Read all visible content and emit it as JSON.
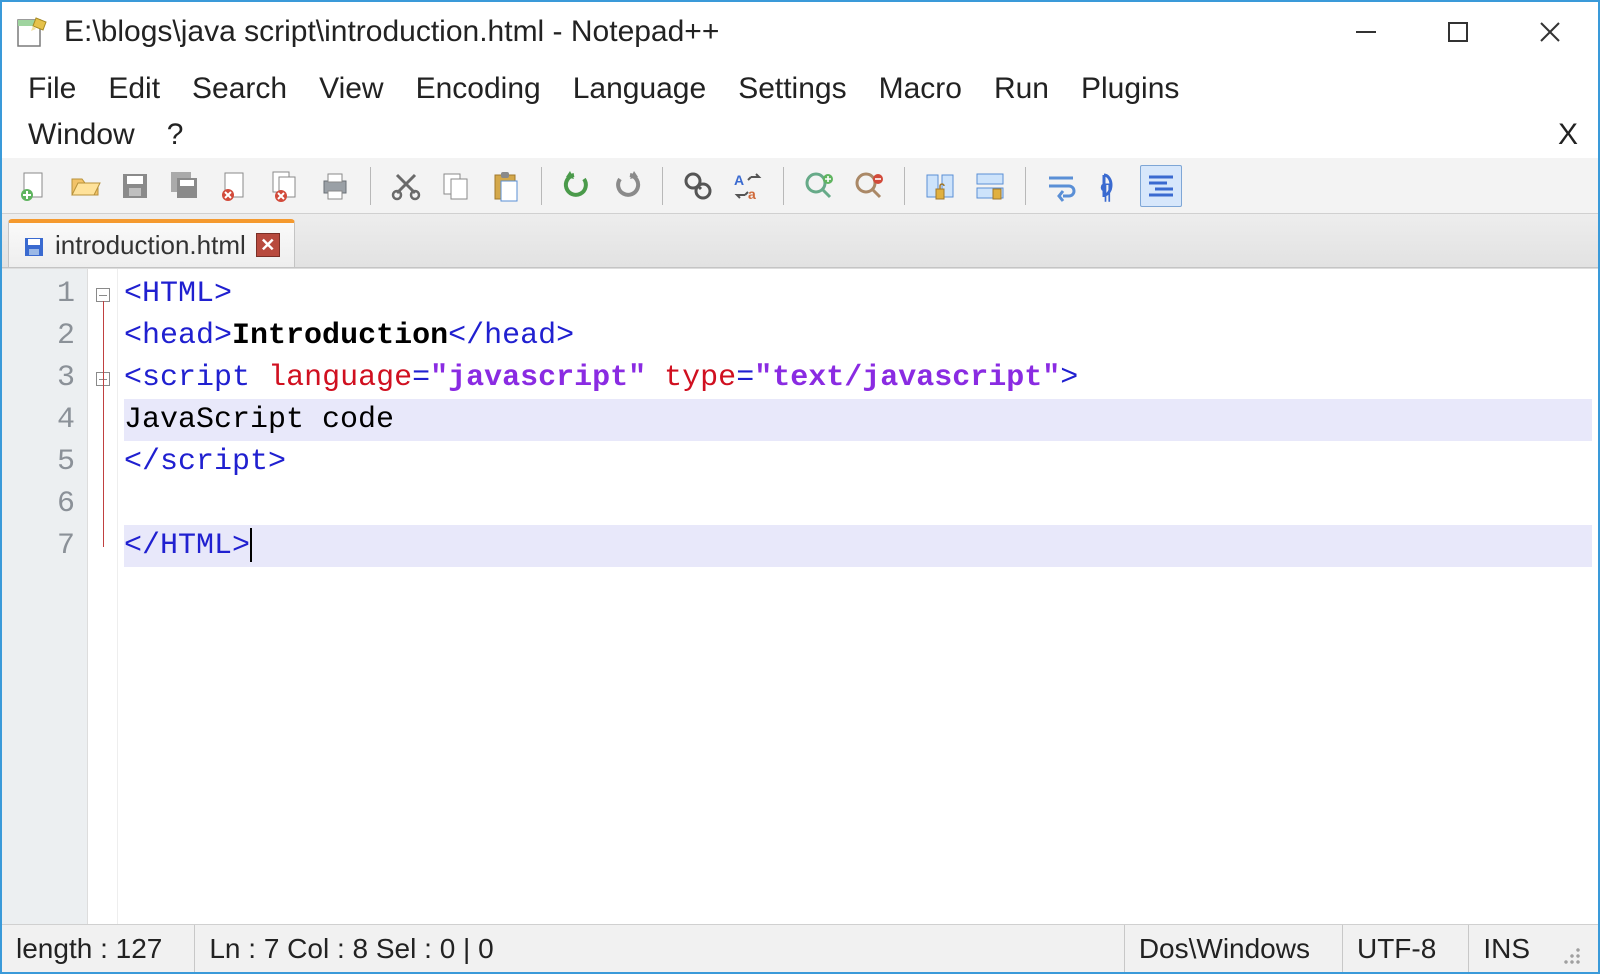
{
  "titlebar": {
    "title": "E:\\blogs\\java script\\introduction.html - Notepad++"
  },
  "menu": {
    "items": [
      "File",
      "Edit",
      "Search",
      "View",
      "Encoding",
      "Language",
      "Settings",
      "Macro",
      "Run",
      "Plugins",
      "Window",
      "?"
    ]
  },
  "toolbar": {
    "icons": [
      "new-file",
      "open-file",
      "save",
      "save-all",
      "close-file",
      "close-all",
      "print",
      "cut",
      "copy",
      "paste",
      "undo",
      "redo",
      "find",
      "replace",
      "zoom-in",
      "zoom-out",
      "sync-v",
      "sync-h",
      "word-wrap",
      "show-all",
      "doc-map"
    ]
  },
  "tab": {
    "filename": "introduction.html"
  },
  "code": {
    "lines": [
      {
        "n": 1,
        "segments": [
          {
            "t": "<",
            "c": "tok-angle"
          },
          {
            "t": "HTML",
            "c": "tok-tag"
          },
          {
            "t": ">",
            "c": "tok-angle"
          }
        ]
      },
      {
        "n": 2,
        "segments": [
          {
            "t": "<",
            "c": "tok-angle"
          },
          {
            "t": "head",
            "c": "tok-tag"
          },
          {
            "t": ">",
            "c": "tok-angle"
          },
          {
            "t": "Introduction",
            "c": "tok-text tok-bold"
          },
          {
            "t": "</",
            "c": "tok-angle"
          },
          {
            "t": "head",
            "c": "tok-tag"
          },
          {
            "t": ">",
            "c": "tok-angle"
          }
        ]
      },
      {
        "n": 3,
        "segments": [
          {
            "t": "<",
            "c": "tok-angle"
          },
          {
            "t": "script",
            "c": "tok-tag"
          },
          {
            "t": " ",
            "c": ""
          },
          {
            "t": "language",
            "c": "tok-attr"
          },
          {
            "t": "=",
            "c": "tok-angle"
          },
          {
            "t": "\"javascript\"",
            "c": "tok-val"
          },
          {
            "t": " ",
            "c": ""
          },
          {
            "t": "type",
            "c": "tok-attr"
          },
          {
            "t": "=",
            "c": "tok-angle"
          },
          {
            "t": "\"text/javascript\"",
            "c": "tok-val"
          },
          {
            "t": ">",
            "c": "tok-angle"
          }
        ]
      },
      {
        "n": 4,
        "hl": true,
        "segments": [
          {
            "t": "JavaScript code",
            "c": "tok-text"
          }
        ]
      },
      {
        "n": 5,
        "segments": [
          {
            "t": "</",
            "c": "tok-angle"
          },
          {
            "t": "script",
            "c": "tok-tag"
          },
          {
            "t": ">",
            "c": "tok-angle"
          }
        ]
      },
      {
        "n": 6,
        "segments": [
          {
            "t": " ",
            "c": ""
          }
        ]
      },
      {
        "n": 7,
        "hl": true,
        "cursor": true,
        "segments": [
          {
            "t": "</",
            "c": "tok-angle"
          },
          {
            "t": "HTML",
            "c": "tok-tag"
          },
          {
            "t": ">",
            "c": "tok-angle"
          }
        ]
      }
    ]
  },
  "status": {
    "length": "length : 127",
    "pos": "Ln : 7    Col : 8    Sel : 0 | 0",
    "eol": "Dos\\Windows",
    "enc": "UTF-8",
    "mode": "INS"
  }
}
